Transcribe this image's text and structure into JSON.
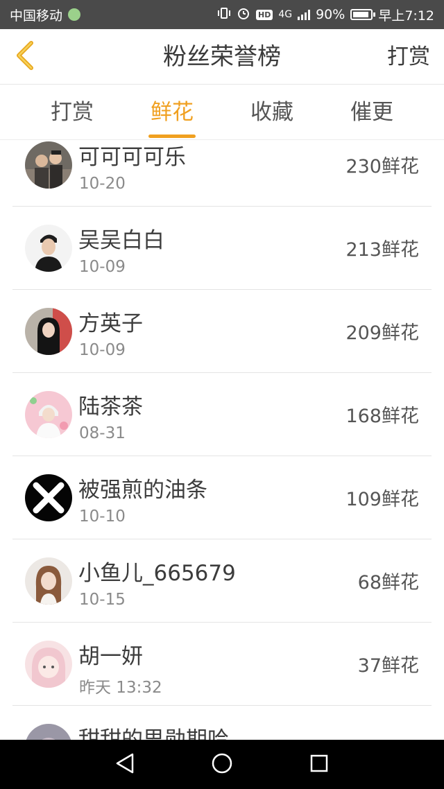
{
  "status_bar": {
    "carrier": "中国移动",
    "network": "4G",
    "hd": "HD",
    "battery": "90%",
    "time": "早上7:12"
  },
  "nav": {
    "title": "粉丝荣誉榜",
    "action": "打赏",
    "back_icon": "chevron-left-icon"
  },
  "tabs": [
    {
      "label": "打赏",
      "active": false
    },
    {
      "label": "鲜花",
      "active": true
    },
    {
      "label": "收藏",
      "active": false
    },
    {
      "label": "催更",
      "active": false
    }
  ],
  "list": [
    {
      "name": "可可可可乐",
      "date": "10-20",
      "value": "230鲜花"
    },
    {
      "name": "吴吴白白",
      "date": "10-09",
      "value": "213鲜花"
    },
    {
      "name": "方英子",
      "date": "10-09",
      "value": "209鲜花"
    },
    {
      "name": "陆茶茶",
      "date": "08-31",
      "value": "168鲜花"
    },
    {
      "name": "被强煎的油条",
      "date": "10-10",
      "value": "109鲜花"
    },
    {
      "name": "小鱼儿_665679",
      "date": "10-15",
      "value": "68鲜花"
    },
    {
      "name": "胡一妍",
      "date": "昨天 13:32",
      "value": "37鲜花"
    },
    {
      "name": "甜甜的思勋期哈",
      "date": "",
      "value": ""
    }
  ],
  "colors": {
    "accent": "#f0a020",
    "status_bar_bg": "#4a4a4a",
    "text_primary": "#3c3c3c",
    "text_secondary": "#8a8a8a"
  }
}
